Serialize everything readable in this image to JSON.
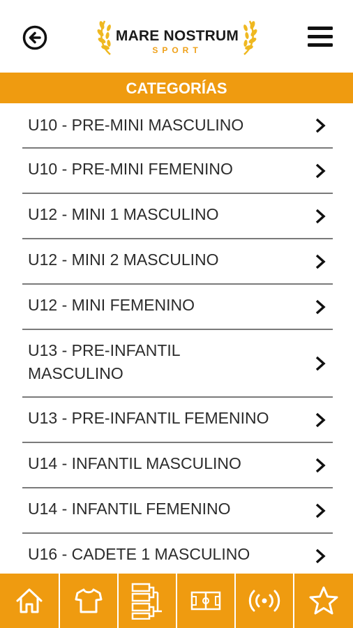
{
  "header": {
    "logo_title": "MARE NOSTRUM",
    "logo_subtitle": "SPORT"
  },
  "section": {
    "title": "CATEGORÍAS"
  },
  "categories": [
    "U10 - PRE-MINI MASCULINO",
    "U10 - PRE-MINI FEMENINO",
    "U12 - MINI 1 MASCULINO",
    "U12 - MINI 2 MASCULINO",
    "U12 - MINI FEMENINO",
    "U13 - PRE-INFANTIL MASCULINO",
    "U13 - PRE-INFANTIL FEMENINO",
    "U14 - INFANTIL MASCULINO",
    "U14 - INFANTIL FEMENINO",
    "U16 - CADETE 1 MASCULINO"
  ],
  "icons": {
    "back": "back-arrow-icon",
    "menu": "hamburger-menu-icon",
    "item": "chevron-right-icon",
    "nav": [
      "home-icon",
      "jersey-icon",
      "bracket-icon",
      "court-icon",
      "live-broadcast-icon",
      "star-icon"
    ]
  },
  "colors": {
    "accent": "#ef9b10",
    "text": "#2b2b2b",
    "divider": "#7a7a7a",
    "logo_dark": "#1b1b1b"
  }
}
